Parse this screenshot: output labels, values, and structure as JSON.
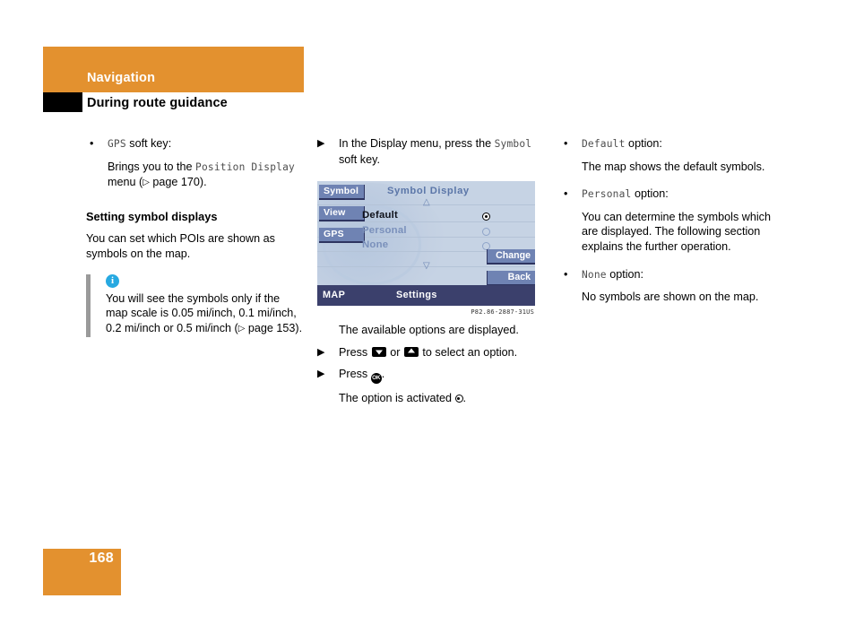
{
  "header": {
    "chapter": "Navigation",
    "section": "During route guidance",
    "orange_hex": "#E3912F"
  },
  "footer": {
    "page_number": "168"
  },
  "left_column": {
    "bullet_gps": {
      "code": "GPS",
      "rest": " soft key:"
    },
    "gps_desc_pre": "Brings you to the ",
    "gps_desc_code": "Position Display",
    "gps_desc_post": " menu (",
    "gps_desc_ref": "page 170).",
    "subhead": "Setting symbol displays",
    "paragraph": "You can set which POIs are shown as symbols on the map.",
    "note": {
      "icon": "info-icon",
      "text": "You will see the symbols only if the map scale is 0.05 mi/inch, 0.1 mi/inch, 0.2 mi/inch or 0.5 mi/inch (",
      "ref": "page 153)."
    }
  },
  "middle_column": {
    "step1_pre": "In the Display menu, press the ",
    "step1_code": "Symbol",
    "step1_post": " soft key.",
    "screen": {
      "softkeys": [
        "Symbol",
        "View",
        "GPS"
      ],
      "title": "Symbol Display",
      "scroll_up": "△",
      "scroll_down": "▽",
      "options": [
        {
          "label": "Default",
          "selected": true
        },
        {
          "label": "Personal",
          "selected": false
        },
        {
          "label": "None",
          "selected": false
        }
      ],
      "buttons": [
        "Change",
        "Back"
      ],
      "bottom_left": "MAP",
      "bottom_center": "Settings",
      "bg_hex": "#C6D3E4",
      "softkey_hex": "#6F83B3",
      "bottombar_hex": "#3B406C"
    },
    "figure_caption": "P82.86-2887-31US",
    "result1": "The available options are displayed.",
    "step2_pre": "Press ",
    "step2_mid": " or ",
    "step2_post": " to select an option.",
    "step3_pre": "Press ",
    "step3_post": ".",
    "result2_pre": "The option is activated ",
    "result2_post": "."
  },
  "right_column": {
    "items": [
      {
        "code": "Default",
        "label": " option:",
        "desc": "The map shows the default symbols."
      },
      {
        "code": "Personal",
        "label": " option:",
        "desc": "You can determine the symbols which are displayed. The following section explains the further operation."
      },
      {
        "code": "None",
        "label": " option:",
        "desc": "No symbols are shown on the map."
      }
    ]
  }
}
